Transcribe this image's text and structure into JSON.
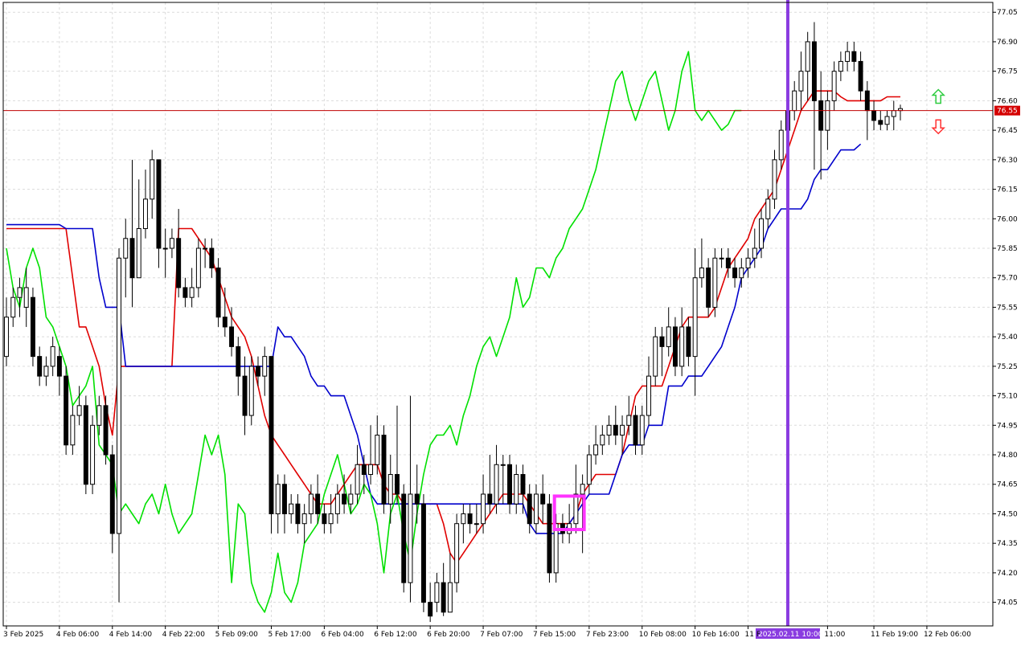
{
  "chart_data": {
    "type": "candlestick",
    "title": "",
    "xlabel": "",
    "ylabel": "",
    "ylim": [
      73.93,
      77.1
    ],
    "grid": true,
    "y_ticks": [
      "77.05",
      "76.90",
      "76.75",
      "76.60",
      "76.45",
      "76.30",
      "76.15",
      "76.00",
      "75.85",
      "75.70",
      "75.55",
      "75.40",
      "75.25",
      "75.10",
      "74.95",
      "74.80",
      "74.65",
      "74.50",
      "74.35",
      "74.20",
      "74.05"
    ],
    "x_tick_labels": [
      {
        "label": "3 Feb 2025",
        "index": 0
      },
      {
        "label": "4 Feb 06:00",
        "index": 8
      },
      {
        "label": "4 Feb 14:00",
        "index": 16
      },
      {
        "label": "4 Feb 22:00",
        "index": 24
      },
      {
        "label": "5 Feb 09:00",
        "index": 32
      },
      {
        "label": "5 Feb 17:00",
        "index": 40
      },
      {
        "label": "6 Feb 04:00",
        "index": 48
      },
      {
        "label": "6 Feb 12:00",
        "index": 56
      },
      {
        "label": "6 Feb 20:00",
        "index": 64
      },
      {
        "label": "7 Feb 07:00",
        "index": 72
      },
      {
        "label": "7 Feb 15:00",
        "index": 80
      },
      {
        "label": "7 Feb 23:00",
        "index": 88
      },
      {
        "label": "10 Feb 08:00",
        "index": 96
      },
      {
        "label": "10 Feb 16:00",
        "index": 104
      },
      {
        "label": "11 F",
        "index": 112
      },
      {
        "label": "11:00",
        "index": 124
      },
      {
        "label": "11 Feb 19:00",
        "index": 131
      },
      {
        "label": "12 Feb 06:00",
        "index": 139
      }
    ],
    "current_price": "76.55",
    "vertical_marker_label": "2025.02.11 10:00",
    "vertical_marker_index": 118,
    "highlight_box": {
      "index_from": 83,
      "index_to": 87,
      "price_from": 74.42,
      "price_to": 74.59
    },
    "arrows": [
      {
        "direction": "up",
        "color": "#2ecc40",
        "index": 140,
        "price": 76.62
      },
      {
        "direction": "down",
        "color": "#ff3030",
        "index": 140,
        "price": 76.47
      }
    ],
    "candles": [
      [
        75.3,
        75.5,
        75.6,
        75.25
      ],
      [
        75.5,
        75.6,
        75.65,
        75.45
      ],
      [
        75.6,
        75.65,
        75.7,
        75.5
      ],
      [
        75.55,
        75.65,
        75.75,
        75.45
      ],
      [
        75.6,
        75.3,
        75.65,
        75.25
      ],
      [
        75.3,
        75.2,
        75.35,
        75.15
      ],
      [
        75.2,
        75.25,
        75.3,
        75.15
      ],
      [
        75.25,
        75.35,
        75.4,
        75.2
      ],
      [
        75.3,
        75.2,
        75.35,
        75.1
      ],
      [
        75.2,
        74.85,
        75.25,
        74.8
      ],
      [
        74.85,
        75.0,
        75.05,
        74.8
      ],
      [
        75.0,
        75.05,
        75.15,
        74.95
      ],
      [
        75.05,
        74.65,
        75.1,
        74.6
      ],
      [
        74.65,
        74.95,
        75.0,
        74.6
      ],
      [
        74.95,
        75.05,
        75.1,
        74.9
      ],
      [
        75.05,
        74.8,
        75.1,
        74.75
      ],
      [
        74.8,
        74.4,
        74.85,
        74.3
      ],
      [
        74.4,
        75.8,
        75.85,
        74.05
      ],
      [
        75.8,
        75.9,
        76.0,
        75.6
      ],
      [
        75.9,
        75.7,
        76.3,
        75.55
      ],
      [
        75.7,
        75.95,
        76.2,
        75.7
      ],
      [
        75.95,
        76.1,
        76.25,
        75.9
      ],
      [
        76.1,
        76.3,
        76.35,
        76.0
      ],
      [
        76.3,
        75.85,
        76.3,
        75.75
      ],
      [
        75.85,
        75.85,
        75.95,
        75.7
      ],
      [
        75.85,
        75.9,
        75.95,
        75.8
      ],
      [
        75.9,
        75.65,
        76.05,
        75.6
      ],
      [
        75.65,
        75.6,
        75.7,
        75.55
      ],
      [
        75.6,
        75.65,
        75.75,
        75.55
      ],
      [
        75.65,
        75.85,
        75.9,
        75.6
      ],
      [
        75.85,
        75.85,
        75.9,
        75.75
      ],
      [
        75.85,
        75.75,
        75.9,
        75.7
      ],
      [
        75.75,
        75.5,
        75.8,
        75.45
      ],
      [
        75.5,
        75.45,
        75.65,
        75.4
      ],
      [
        75.45,
        75.35,
        75.55,
        75.3
      ],
      [
        75.35,
        75.2,
        75.4,
        75.1
      ],
      [
        75.2,
        75.0,
        75.3,
        74.9
      ],
      [
        75.0,
        75.25,
        75.3,
        74.95
      ],
      [
        75.25,
        75.2,
        75.3,
        75.15
      ],
      [
        75.2,
        75.3,
        75.35,
        75.1
      ],
      [
        75.3,
        74.5,
        75.3,
        74.4
      ],
      [
        74.5,
        74.65,
        74.7,
        74.4
      ],
      [
        74.65,
        74.5,
        74.7,
        74.4
      ],
      [
        74.5,
        74.55,
        74.6,
        74.45
      ],
      [
        74.55,
        74.45,
        74.6,
        74.4
      ],
      [
        74.45,
        74.5,
        74.55,
        74.35
      ],
      [
        74.5,
        74.6,
        74.65,
        74.45
      ],
      [
        74.6,
        74.5,
        74.7,
        74.45
      ],
      [
        74.5,
        74.45,
        74.55,
        74.4
      ],
      [
        74.45,
        74.5,
        74.6,
        74.4
      ],
      [
        74.5,
        74.6,
        74.65,
        74.45
      ],
      [
        74.6,
        74.55,
        74.7,
        74.5
      ],
      [
        74.55,
        74.6,
        74.65,
        74.5
      ],
      [
        74.6,
        74.75,
        74.85,
        74.55
      ],
      [
        74.75,
        74.7,
        74.8,
        74.6
      ],
      [
        74.7,
        74.75,
        74.95,
        74.65
      ],
      [
        74.75,
        74.9,
        75.0,
        74.7
      ],
      [
        74.9,
        74.55,
        74.95,
        74.5
      ],
      [
        74.55,
        74.7,
        74.8,
        74.45
      ],
      [
        74.7,
        74.6,
        75.05,
        74.55
      ],
      [
        74.6,
        74.15,
        74.65,
        74.1
      ],
      [
        74.15,
        74.6,
        75.1,
        74.05
      ],
      [
        74.6,
        74.55,
        74.75,
        74.45
      ],
      [
        74.55,
        74.05,
        74.6,
        74.0
      ],
      [
        74.05,
        73.98,
        74.15,
        73.95
      ],
      [
        74.05,
        74.15,
        74.2,
        74.0
      ],
      [
        74.15,
        74.0,
        74.25,
        73.98
      ],
      [
        74.0,
        74.15,
        74.3,
        74.0
      ],
      [
        74.15,
        74.45,
        74.5,
        74.1
      ],
      [
        74.45,
        74.5,
        74.55,
        74.35
      ],
      [
        74.5,
        74.45,
        74.55,
        74.4
      ],
      [
        74.45,
        74.45,
        74.55,
        74.4
      ],
      [
        74.45,
        74.6,
        74.7,
        74.4
      ],
      [
        74.6,
        74.55,
        74.8,
        74.5
      ],
      [
        74.55,
        74.75,
        74.85,
        74.5
      ],
      [
        74.75,
        74.75,
        74.8,
        74.55
      ],
      [
        74.75,
        74.55,
        74.8,
        74.5
      ],
      [
        74.55,
        74.7,
        74.75,
        74.5
      ],
      [
        74.7,
        74.6,
        74.75,
        74.5
      ],
      [
        74.6,
        74.45,
        74.65,
        74.4
      ],
      [
        74.45,
        74.6,
        74.65,
        74.4
      ],
      [
        74.6,
        74.55,
        74.7,
        74.45
      ],
      [
        74.55,
        74.2,
        74.6,
        74.15
      ],
      [
        74.2,
        74.45,
        74.5,
        74.15
      ],
      [
        74.45,
        74.4,
        74.5,
        74.35
      ],
      [
        74.4,
        74.45,
        74.55,
        74.35
      ],
      [
        74.45,
        74.6,
        74.75,
        74.4
      ],
      [
        74.6,
        74.65,
        74.7,
        74.3
      ],
      [
        74.65,
        74.8,
        74.85,
        74.6
      ],
      [
        74.8,
        74.85,
        74.95,
        74.75
      ],
      [
        74.85,
        74.9,
        74.95,
        74.8
      ],
      [
        74.9,
        74.95,
        75.0,
        74.85
      ],
      [
        74.95,
        74.9,
        75.05,
        74.85
      ],
      [
        74.9,
        74.95,
        75.0,
        74.8
      ],
      [
        74.95,
        75.0,
        75.1,
        74.9
      ],
      [
        75.0,
        74.85,
        75.05,
        74.8
      ],
      [
        74.85,
        75.0,
        75.05,
        74.8
      ],
      [
        75.0,
        75.2,
        75.3,
        74.95
      ],
      [
        75.2,
        75.4,
        75.45,
        75.15
      ],
      [
        75.4,
        75.35,
        75.45,
        75.2
      ],
      [
        75.35,
        75.45,
        75.55,
        75.3
      ],
      [
        75.45,
        75.25,
        75.5,
        75.2
      ],
      [
        75.25,
        75.45,
        75.55,
        75.2
      ],
      [
        75.45,
        75.3,
        75.5,
        75.25
      ],
      [
        75.3,
        75.7,
        75.85,
        75.1
      ],
      [
        75.7,
        75.75,
        75.9,
        75.65
      ],
      [
        75.75,
        75.55,
        75.8,
        75.5
      ],
      [
        75.55,
        75.8,
        75.85,
        75.5
      ],
      [
        75.8,
        75.8,
        75.85,
        75.75
      ],
      [
        75.8,
        75.75,
        75.85,
        75.7
      ],
      [
        75.75,
        75.7,
        75.8,
        75.65
      ],
      [
        75.7,
        75.75,
        75.8,
        75.65
      ],
      [
        75.75,
        75.8,
        75.85,
        75.7
      ],
      [
        75.8,
        75.85,
        75.95,
        75.75
      ],
      [
        75.85,
        76.0,
        76.05,
        75.8
      ],
      [
        76.0,
        76.1,
        76.15,
        75.95
      ],
      [
        76.1,
        76.3,
        76.35,
        76.05
      ],
      [
        76.3,
        76.45,
        76.5,
        76.25
      ],
      [
        76.45,
        76.55,
        76.6,
        76.4
      ],
      [
        76.55,
        76.65,
        76.7,
        76.5
      ],
      [
        76.65,
        76.75,
        76.85,
        76.55
      ],
      [
        76.75,
        76.9,
        76.95,
        76.6
      ],
      [
        76.9,
        76.6,
        77.0,
        76.25
      ],
      [
        76.6,
        76.45,
        76.75,
        76.2
      ],
      [
        76.45,
        76.6,
        76.65,
        76.35
      ],
      [
        76.6,
        76.75,
        76.8,
        76.55
      ],
      [
        76.75,
        76.8,
        76.85,
        76.7
      ],
      [
        76.8,
        76.85,
        76.9,
        76.75
      ],
      [
        76.85,
        76.8,
        76.9,
        76.75
      ],
      [
        76.8,
        76.65,
        76.85,
        76.6
      ],
      [
        76.65,
        76.55,
        76.7,
        76.4
      ],
      [
        76.55,
        76.5,
        76.6,
        76.45
      ],
      [
        76.5,
        76.48,
        76.55,
        76.45
      ],
      [
        76.48,
        76.52,
        76.55,
        76.45
      ],
      [
        76.52,
        76.55,
        76.6,
        76.45
      ],
      [
        76.55,
        76.56,
        76.58,
        76.5
      ]
    ],
    "series": [
      {
        "color": "#e00000",
        "values": [
          75.95,
          75.95,
          75.95,
          75.95,
          75.95,
          75.95,
          75.95,
          75.95,
          75.95,
          75.95,
          75.7,
          75.45,
          75.45,
          75.35,
          75.25,
          75.05,
          74.9,
          75.25,
          75.25,
          75.25,
          75.25,
          75.25,
          75.25,
          75.25,
          75.25,
          75.25,
          75.95,
          75.95,
          75.95,
          75.9,
          75.85,
          75.8,
          75.7,
          75.6,
          75.5,
          75.45,
          75.4,
          75.3,
          75.15,
          75.0,
          74.9,
          74.85,
          74.8,
          74.75,
          74.7,
          74.65,
          74.6,
          74.55,
          74.55,
          74.55,
          74.6,
          74.65,
          74.7,
          74.75,
          74.75,
          74.75,
          74.75,
          74.65,
          74.6,
          74.6,
          74.55,
          74.55,
          74.55,
          74.55,
          74.55,
          74.55,
          74.45,
          74.3,
          74.25,
          74.3,
          74.35,
          74.4,
          74.45,
          74.5,
          74.55,
          74.6,
          74.6,
          74.6,
          74.6,
          74.55,
          74.5,
          74.45,
          74.45,
          74.45,
          74.45,
          74.45,
          74.5,
          74.6,
          74.65,
          74.7,
          74.7,
          74.7,
          74.7,
          74.8,
          74.95,
          75.1,
          75.15,
          75.15,
          75.15,
          75.15,
          75.25,
          75.35,
          75.45,
          75.5,
          75.5,
          75.5,
          75.5,
          75.55,
          75.65,
          75.75,
          75.8,
          75.85,
          75.9,
          76.0,
          76.05,
          76.1,
          76.15,
          76.25,
          76.35,
          76.45,
          76.55,
          76.6,
          76.65,
          76.65,
          76.65,
          76.65,
          76.62,
          76.6,
          76.6,
          76.6,
          76.6,
          76.6,
          76.6,
          76.62,
          76.62,
          76.62
        ]
      },
      {
        "color": "#0000cc",
        "values": [
          75.97,
          75.97,
          75.97,
          75.97,
          75.97,
          75.97,
          75.97,
          75.97,
          75.97,
          75.95,
          75.95,
          75.95,
          75.95,
          75.95,
          75.7,
          75.55,
          75.55,
          75.55,
          75.25,
          75.25,
          75.25,
          75.25,
          75.25,
          75.25,
          75.25,
          75.25,
          75.25,
          75.25,
          75.25,
          75.25,
          75.25,
          75.25,
          75.25,
          75.25,
          75.25,
          75.25,
          75.25,
          75.25,
          75.25,
          75.25,
          75.25,
          75.45,
          75.4,
          75.4,
          75.35,
          75.3,
          75.2,
          75.15,
          75.15,
          75.1,
          75.1,
          75.1,
          75.0,
          74.9,
          74.75,
          74.6,
          74.55,
          74.55,
          74.55,
          74.55,
          74.55,
          74.55,
          74.55,
          74.55,
          74.55,
          74.55,
          74.55,
          74.55,
          74.55,
          74.55,
          74.55,
          74.55,
          74.55,
          74.55,
          74.55,
          74.55,
          74.55,
          74.55,
          74.55,
          74.45,
          74.4,
          74.4,
          74.4,
          74.4,
          74.4,
          74.45,
          74.5,
          74.55,
          74.6,
          74.6,
          74.6,
          74.6,
          74.7,
          74.8,
          74.85,
          74.85,
          74.85,
          74.95,
          74.95,
          74.95,
          75.15,
          75.15,
          75.15,
          75.2,
          75.2,
          75.2,
          75.25,
          75.3,
          75.35,
          75.45,
          75.55,
          75.7,
          75.75,
          75.8,
          75.85,
          75.95,
          76.0,
          76.05,
          76.05,
          76.05,
          76.05,
          76.1,
          76.2,
          76.25,
          76.25,
          76.3,
          76.35,
          76.35,
          76.35,
          76.38
        ]
      },
      {
        "color": "#00e000",
        "values": [
          75.85,
          75.65,
          75.55,
          75.75,
          75.85,
          75.75,
          75.5,
          75.45,
          75.35,
          75.25,
          75.05,
          75.1,
          75.15,
          75.25,
          74.85,
          74.8,
          74.75,
          74.5,
          74.55,
          74.5,
          74.45,
          74.55,
          74.6,
          74.5,
          74.65,
          74.5,
          74.4,
          74.45,
          74.5,
          74.7,
          74.9,
          74.8,
          74.9,
          74.7,
          74.15,
          74.55,
          74.5,
          74.15,
          74.05,
          74.0,
          74.1,
          74.3,
          74.1,
          74.05,
          74.15,
          74.35,
          74.4,
          74.45,
          74.6,
          74.7,
          74.8,
          74.65,
          74.5,
          74.55,
          74.65,
          74.6,
          74.45,
          74.2,
          74.5,
          74.6,
          74.4,
          74.25,
          74.5,
          74.7,
          74.85,
          74.9,
          74.9,
          74.95,
          74.85,
          75.0,
          75.1,
          75.25,
          75.35,
          75.4,
          75.3,
          75.4,
          75.5,
          75.7,
          75.55,
          75.6,
          75.75,
          75.75,
          75.7,
          75.8,
          75.85,
          75.95,
          76.0,
          76.05,
          76.15,
          76.25,
          76.4,
          76.55,
          76.7,
          76.75,
          76.6,
          76.5,
          76.6,
          76.7,
          76.75,
          76.6,
          76.45,
          76.55,
          76.75,
          76.85,
          76.55,
          76.5,
          76.55,
          76.5,
          76.45,
          76.48,
          76.55,
          76.55
        ]
      }
    ]
  }
}
